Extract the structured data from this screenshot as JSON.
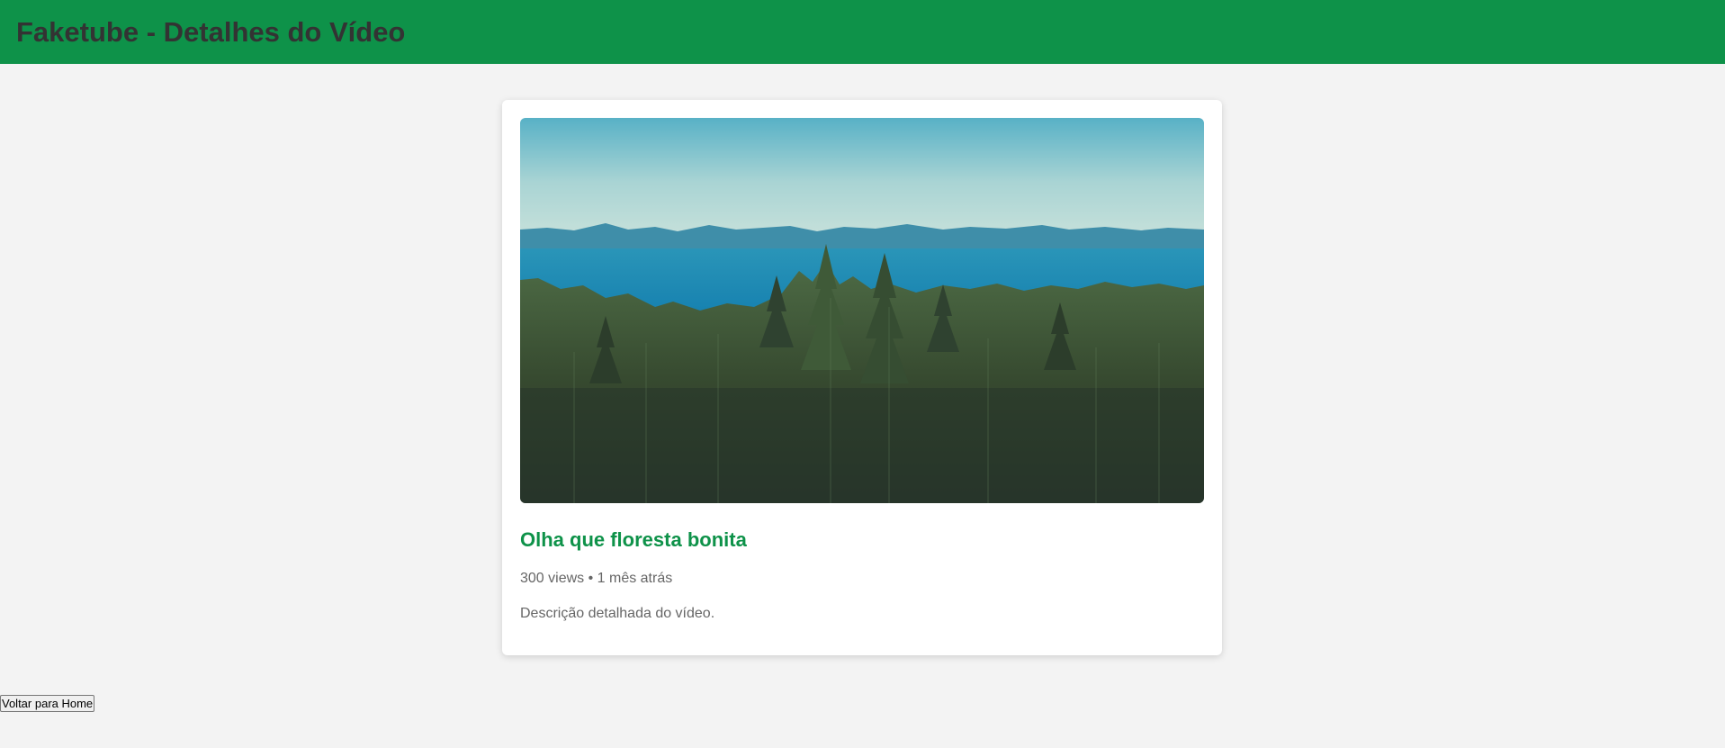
{
  "header": {
    "title": "Faketube - Detalhes do Vídeo"
  },
  "video": {
    "thumbnail_alt": "floresta",
    "title": "Olha que floresta bonita",
    "meta": "300 views • 1 mês atrás",
    "description": "Descrição detalhada do vídeo."
  },
  "actions": {
    "back_label": "Voltar para Home"
  },
  "colors": {
    "brand": "#0e9249",
    "background": "#f3f3f3",
    "header_text": "#333333",
    "muted_text": "#666666"
  }
}
